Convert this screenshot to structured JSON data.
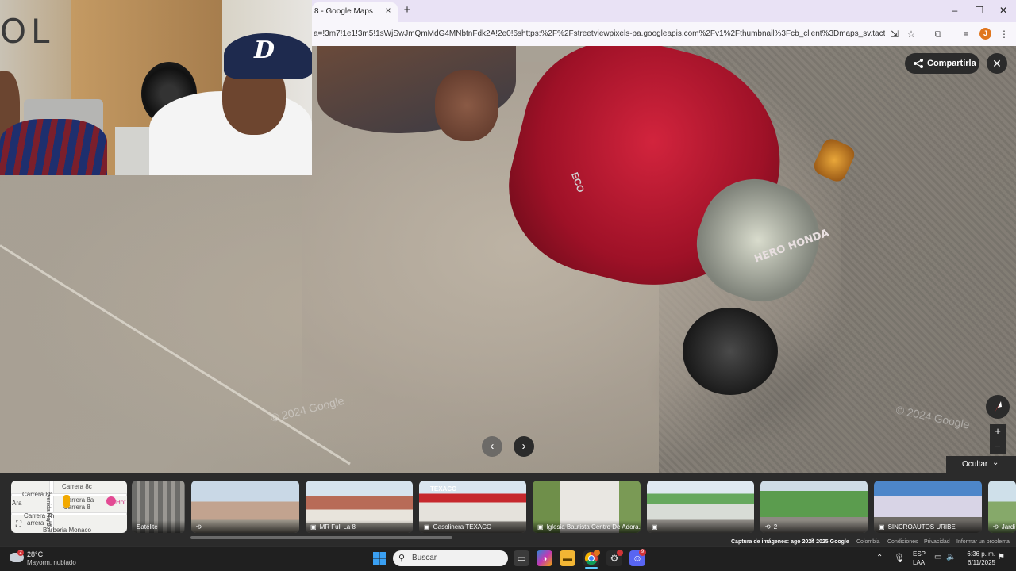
{
  "browser": {
    "tab_title": "8 - Google Maps",
    "url": "a=!3m7!1e1!3m5!1sWjSwJmQmMdG4MNbtnFdk2A!2e0!6shttps:%2F%2Fstreetviewpixels-pa.googleapis.com%2Fv1%2Fthumbnail%3Fcb_client%3Dmaps_sv.tactile%26w%3D...",
    "new_tab": "+",
    "tab_close": "×",
    "window_buttons": [
      "–",
      "❐",
      "✕"
    ],
    "profile_initial": "J"
  },
  "webcam": {
    "sign_text": "OL",
    "cap_logo": "D"
  },
  "streetview": {
    "share_label": "Compartirla",
    "close_label": "✕",
    "watermarks": [
      "© 2024 Google",
      "© 2024 Google"
    ],
    "moto_brand": "HERO HONDA",
    "moto_model": "ECO",
    "zoom_in": "+",
    "zoom_out": "−",
    "prev_arrow": "‹",
    "next_arrow": "›",
    "hide_label": "Ocultar"
  },
  "minimap": {
    "labels": [
      "Carrera 8c",
      "Carrera 8b",
      "Carrera 8a",
      "Carrera 8",
      "Carrera 7h",
      "arrera 7g",
      "Barberia Monaco",
      "Ara",
      "Hot",
      "venida Murillo"
    ]
  },
  "thumbnails": [
    {
      "label": "Satélite",
      "icon": ""
    },
    {
      "label": "",
      "icon": "360"
    },
    {
      "label": "MR Full La 8",
      "icon": "cam"
    },
    {
      "label": "Gasolinera TEXACO",
      "icon": "cam"
    },
    {
      "label": "Iglesia Bautista Centro De Adora...",
      "icon": "cam"
    },
    {
      "label": "",
      "icon": "cam"
    },
    {
      "label": "2",
      "icon": "360"
    },
    {
      "label": "SINCROAUTOS URIBE",
      "icon": "cam"
    },
    {
      "label": "Jardi",
      "icon": "360"
    }
  ],
  "footer": {
    "capture": "Captura de imágenes: ago 2024",
    "copyright": "© 2025 Google",
    "country": "Colombia",
    "terms": "Condiciones",
    "privacy": "Privacidad",
    "report": "Informar un problema"
  },
  "taskbar": {
    "weather_temp": "28°C",
    "weather_desc": "Mayorm. nublado",
    "weather_badge": "2",
    "search_placeholder": "Buscar",
    "lang": "ESP",
    "lang_sub": "LAA",
    "time": "6:36 p. m.",
    "date": "6/11/2025",
    "discord_badge": "9"
  }
}
